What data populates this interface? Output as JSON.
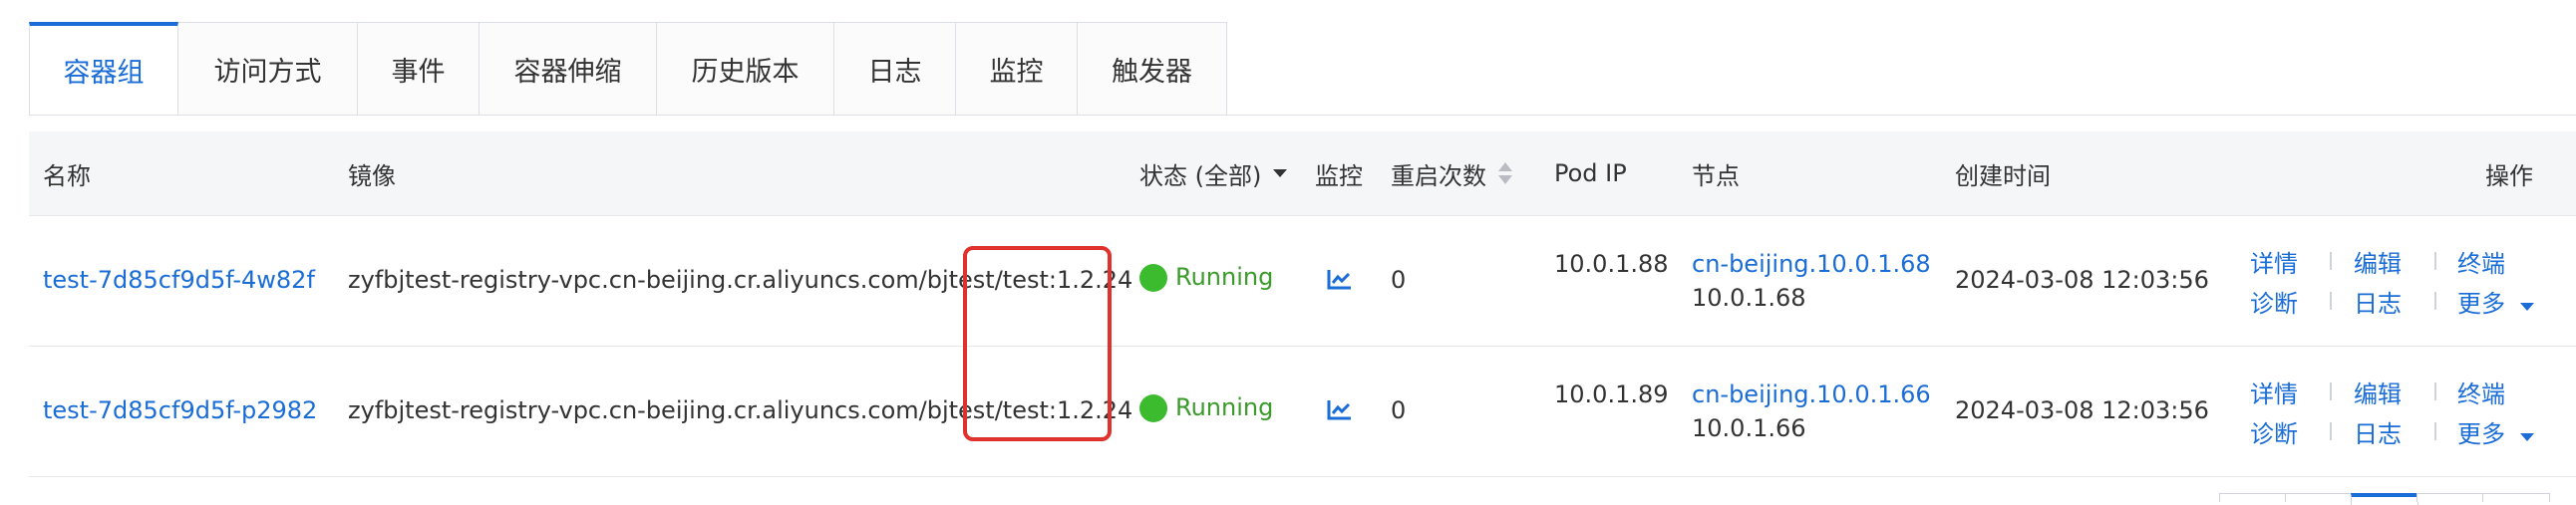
{
  "tabs": [
    "容器组",
    "访问方式",
    "事件",
    "容器伸缩",
    "历史版本",
    "日志",
    "监控",
    "触发器"
  ],
  "columns": {
    "name": "名称",
    "image": "镜像",
    "status": "状态 (全部)",
    "monitor": "监控",
    "restarts": "重启次数",
    "pod_ip": "Pod IP",
    "node": "节点",
    "created": "创建时间",
    "actions": "操作"
  },
  "rows": [
    {
      "name": "test-7d85cf9d5f-4w82f",
      "image": "zyfbjtest-registry-vpc.cn-beijing.cr.aliyuncs.com/bjtest/test:1.2.24",
      "status": "Running",
      "restarts": "0",
      "pod_ip": "10.0.1.88",
      "node_name": "cn-beijing.10.0.1.68",
      "node_ip": "10.0.1.68",
      "created": "2024-03-08 12:03:56"
    },
    {
      "name": "test-7d85cf9d5f-p2982",
      "image": "zyfbjtest-registry-vpc.cn-beijing.cr.aliyuncs.com/bjtest/test:1.2.24",
      "status": "Running",
      "restarts": "0",
      "pod_ip": "10.0.1.89",
      "node_name": "cn-beijing.10.0.1.66",
      "node_ip": "10.0.1.66",
      "created": "2024-03-08 12:03:56"
    }
  ],
  "actions": {
    "detail": "详情",
    "edit": "编辑",
    "terminal": "终端",
    "diagnose": "诊断",
    "logs": "日志",
    "more": "更多"
  },
  "colors": {
    "accent": "#1a6cd6",
    "running": "#3dbb2f",
    "highlight": "#e0322d"
  }
}
